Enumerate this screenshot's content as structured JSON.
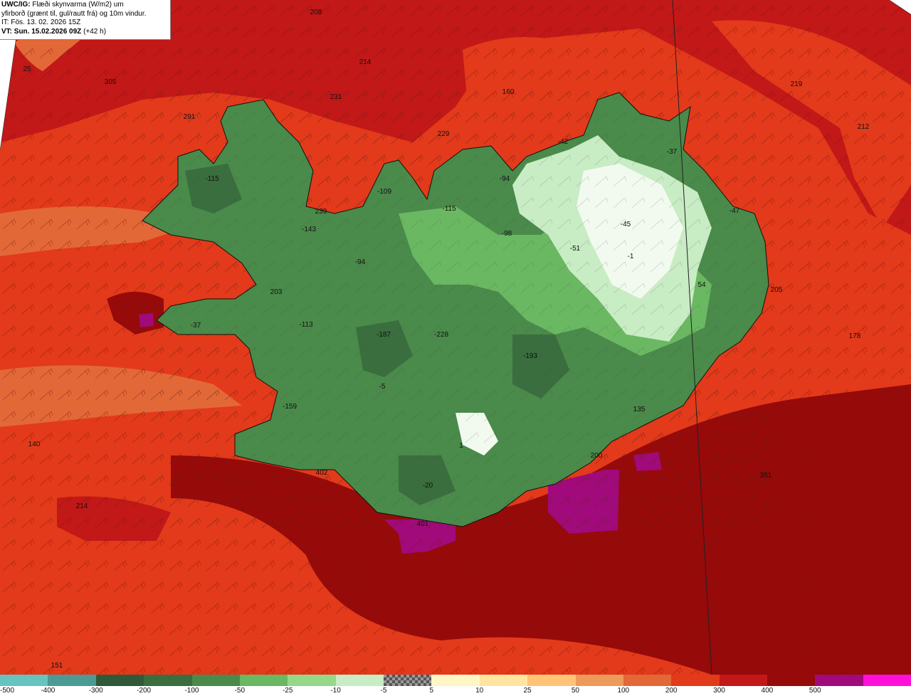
{
  "header": {
    "line1_bold": "UWC/IG:",
    "line1": "Flæði skynvarma (W/m2) um",
    "line2": "yfirborð (grænt til, gul/rautt frá) og 10m vindur.",
    "line3": "IT: Fös. 13. 02. 2026 15Z",
    "line4_bold": "VT: Sun. 15.02.2026 09Z",
    "line4": "(+42 h)"
  },
  "map_values": [
    {
      "id": "v-208",
      "text": "208"
    },
    {
      "id": "v-25",
      "text": "25"
    },
    {
      "id": "v-214a",
      "text": "214"
    },
    {
      "id": "v-305",
      "text": "305"
    },
    {
      "id": "v-231",
      "text": "231"
    },
    {
      "id": "v-160",
      "text": "160"
    },
    {
      "id": "v-219",
      "text": "219"
    },
    {
      "id": "v-291",
      "text": "291"
    },
    {
      "id": "v-229",
      "text": "229"
    },
    {
      "id": "v-212",
      "text": "212"
    },
    {
      "id": "v-42",
      "text": "-42"
    },
    {
      "id": "v-37",
      "text": "-37"
    },
    {
      "id": "v-115",
      "text": "-115"
    },
    {
      "id": "v-94a",
      "text": "-94"
    },
    {
      "id": "v-109",
      "text": "-109"
    },
    {
      "id": "v-115b",
      "text": "-115"
    },
    {
      "id": "v-239",
      "text": "239"
    },
    {
      "id": "v-143",
      "text": "-143"
    },
    {
      "id": "v-98",
      "text": "-98"
    },
    {
      "id": "v-47",
      "text": "-47"
    },
    {
      "id": "v-45",
      "text": "-45"
    },
    {
      "id": "v-51",
      "text": "-51"
    },
    {
      "id": "v-1",
      "text": "-1"
    },
    {
      "id": "v-94b",
      "text": "-94"
    },
    {
      "id": "v-203",
      "text": "203"
    },
    {
      "id": "v-54",
      "text": "54"
    },
    {
      "id": "v-205",
      "text": "205"
    },
    {
      "id": "v-113",
      "text": "-113"
    },
    {
      "id": "v-187",
      "text": "-187"
    },
    {
      "id": "v-228",
      "text": "-228"
    },
    {
      "id": "v-193",
      "text": "-193"
    },
    {
      "id": "v-178",
      "text": "178"
    },
    {
      "id": "v-5",
      "text": "-5"
    },
    {
      "id": "v-159",
      "text": "-159"
    },
    {
      "id": "v-135",
      "text": "135"
    },
    {
      "id": "v-140",
      "text": "140"
    },
    {
      "id": "v-1b",
      "text": "1"
    },
    {
      "id": "v-200",
      "text": "200"
    },
    {
      "id": "v-402",
      "text": "402"
    },
    {
      "id": "v-351",
      "text": "351"
    },
    {
      "id": "v-20",
      "text": "-20"
    },
    {
      "id": "v-214b",
      "text": "214"
    },
    {
      "id": "v-401",
      "text": "401"
    },
    {
      "id": "v-151",
      "text": "151"
    },
    {
      "id": "v-37b",
      "text": "-37"
    }
  ],
  "legend": {
    "colors": [
      "#66c4c0",
      "#4c9a94",
      "#2e5a3a",
      "#3a6e3e",
      "#4a8a4a",
      "#6ab862",
      "#95d88a",
      "#c8ecc4",
      "checker",
      "#fff6c6",
      "#ffe6a0",
      "#ffc478",
      "#ee9a5a",
      "#e26838",
      "#e23a1a",
      "#c21818",
      "#960a0a",
      "#a00a7a",
      "#ff10d8"
    ],
    "labels": [
      "-500",
      "-400",
      "-300",
      "-200",
      "-100",
      "-50",
      "-25",
      "-10",
      "-5",
      "5",
      "10",
      "25",
      "50",
      "100",
      "200",
      "300",
      "400",
      "500"
    ]
  },
  "colors": {
    "sea_main": "#e23a1a",
    "sea_orange": "#e26838",
    "sea_dark": "#c21818",
    "sea_darker": "#960a0a",
    "magenta": "#a00a7a",
    "land_green": "#4a8a4a",
    "land_light": "#95d88a",
    "land_white": "#f2faf0"
  }
}
